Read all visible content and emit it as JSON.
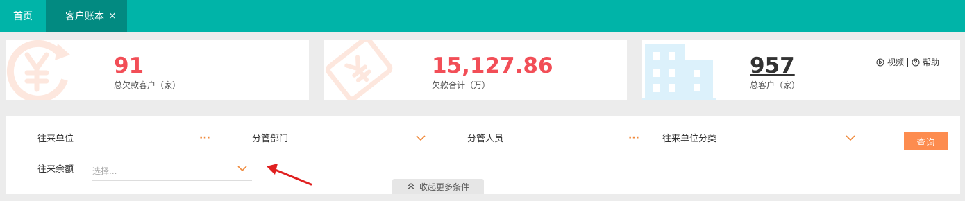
{
  "tabs": {
    "home": "首页",
    "ledger": "客户账本",
    "close_glyph": "×"
  },
  "stats": [
    {
      "value": "91",
      "label": "总欠款客户（家）",
      "color": "#f24e57"
    },
    {
      "value": "15,127.86",
      "label": "欠款合计（万）",
      "color": "#f24e57"
    },
    {
      "value": "957",
      "label": "总客户（家）",
      "color": "#333333"
    }
  ],
  "help_links": {
    "video": "视频",
    "help": "帮助"
  },
  "filters": {
    "counterparty_label": "往来单位",
    "department_label": "分管部门",
    "staff_label": "分管人员",
    "category_label": "往来单位分类",
    "balance_label": "往来余额",
    "balance_placeholder": "选择...",
    "more_glyph": "···",
    "search_button": "查询",
    "collapse_label": "收起更多条件"
  },
  "colors": {
    "topbar": "#00b4a8",
    "active_tab": "#028a81",
    "accent_orange": "#fd8c4f",
    "stat_red": "#f24e57"
  },
  "icons": {
    "card1": "yen-refresh-icon",
    "card2": "yen-tag-icon",
    "card3": "building-icon"
  }
}
